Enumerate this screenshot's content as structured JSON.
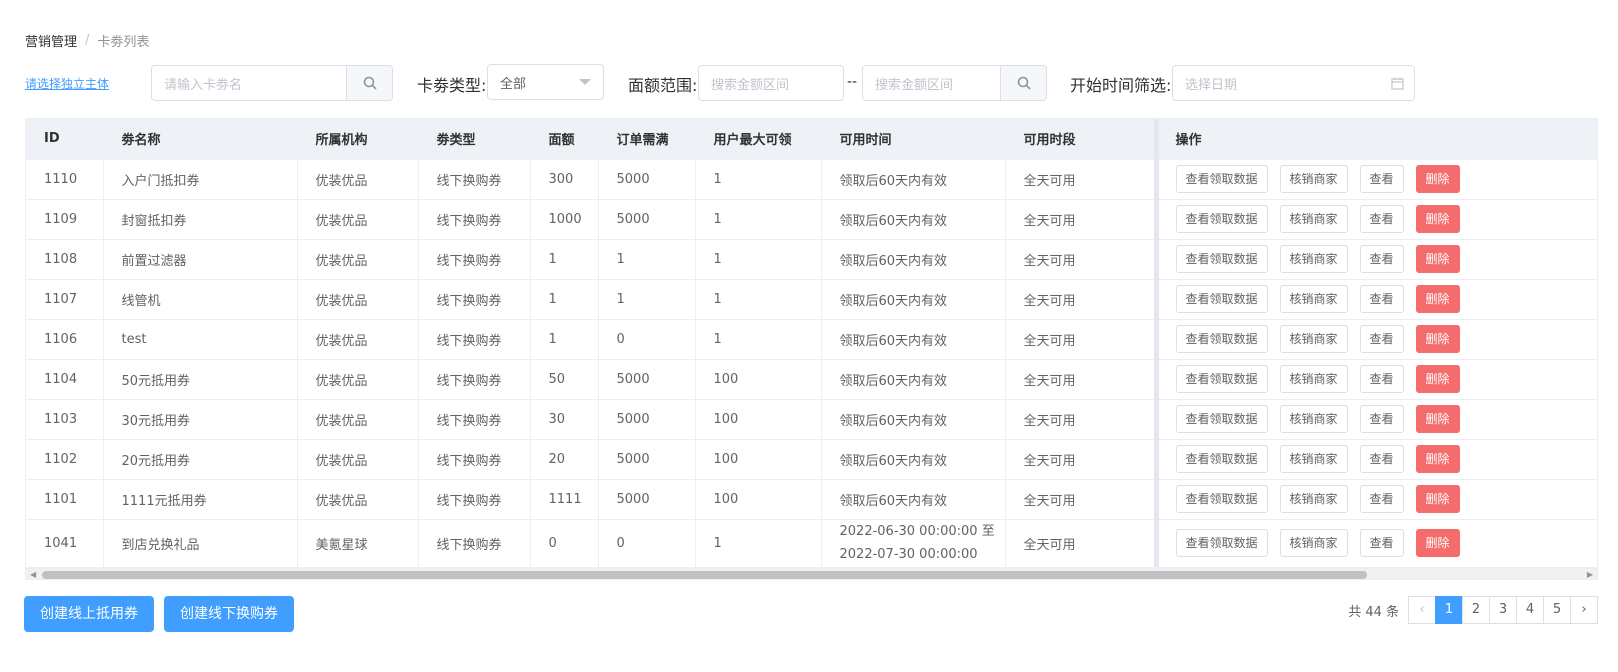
{
  "breadcrumb": {
    "root": "营销管理",
    "separator": "/",
    "current": "卡劵列表"
  },
  "filters": {
    "entity_link": "请选择独立主体",
    "name_placeholder": "请输入卡劵名",
    "type_label": "卡劵类型:",
    "type_value": "全部",
    "amount_label": "面额范围:",
    "amount_min_placeholder": "搜索金额区间",
    "amount_sep": "--",
    "amount_max_placeholder": "搜索金额区间",
    "start_label": "开始时间筛选:",
    "date_placeholder": "选择日期"
  },
  "table": {
    "headers": [
      "ID",
      "劵名称",
      "所属机构",
      "劵类型",
      "面额",
      "订单需满",
      "用户最大可领",
      "可用时间",
      "可用时段",
      "操作"
    ],
    "rows": [
      [
        "1110",
        "入户门抵扣券",
        "优装优品",
        "线下换购券",
        "300",
        "5000",
        "1",
        "领取后60天内有效",
        "全天可用"
      ],
      [
        "1109",
        "封窗抵扣券",
        "优装优品",
        "线下换购券",
        "1000",
        "5000",
        "1",
        "领取后60天内有效",
        "全天可用"
      ],
      [
        "1108",
        "前置过滤器",
        "优装优品",
        "线下换购券",
        "1",
        "1",
        "1",
        "领取后60天内有效",
        "全天可用"
      ],
      [
        "1107",
        "线管机",
        "优装优品",
        "线下换购券",
        "1",
        "1",
        "1",
        "领取后60天内有效",
        "全天可用"
      ],
      [
        "1106",
        "test",
        "优装优品",
        "线下换购券",
        "1",
        "0",
        "1",
        "领取后60天内有效",
        "全天可用"
      ],
      [
        "1104",
        "50元抵用券",
        "优装优品",
        "线下换购券",
        "50",
        "5000",
        "100",
        "领取后60天内有效",
        "全天可用"
      ],
      [
        "1103",
        "30元抵用券",
        "优装优品",
        "线下换购券",
        "30",
        "5000",
        "100",
        "领取后60天内有效",
        "全天可用"
      ],
      [
        "1102",
        "20元抵用券",
        "优装优品",
        "线下换购券",
        "20",
        "5000",
        "100",
        "领取后60天内有效",
        "全天可用"
      ],
      [
        "1101",
        "1111元抵用券",
        "优装优品",
        "线下换购券",
        "1111",
        "5000",
        "100",
        "领取后60天内有效",
        "全天可用"
      ],
      [
        "1041",
        "到店兑换礼品",
        "美氪星球",
        "线下换购券",
        "0",
        "0",
        "1",
        "2022-06-30 00:00:00 至 2022-07-30 00:00:00",
        "全天可用"
      ]
    ],
    "actions": {
      "view_data": "查看领取数据",
      "merchant": "核销商家",
      "view": "查看",
      "delete": "删除"
    }
  },
  "buttons": {
    "create_online": "创建线上抵用券",
    "create_offline": "创建线下换购券"
  },
  "pagination": {
    "total": "共 44 条",
    "pages": [
      "1",
      "2",
      "3",
      "4",
      "5"
    ],
    "current": "1"
  },
  "colors": {
    "primary": "#409eff",
    "danger": "#f56c6c",
    "header_bg": "#eef1f6"
  }
}
